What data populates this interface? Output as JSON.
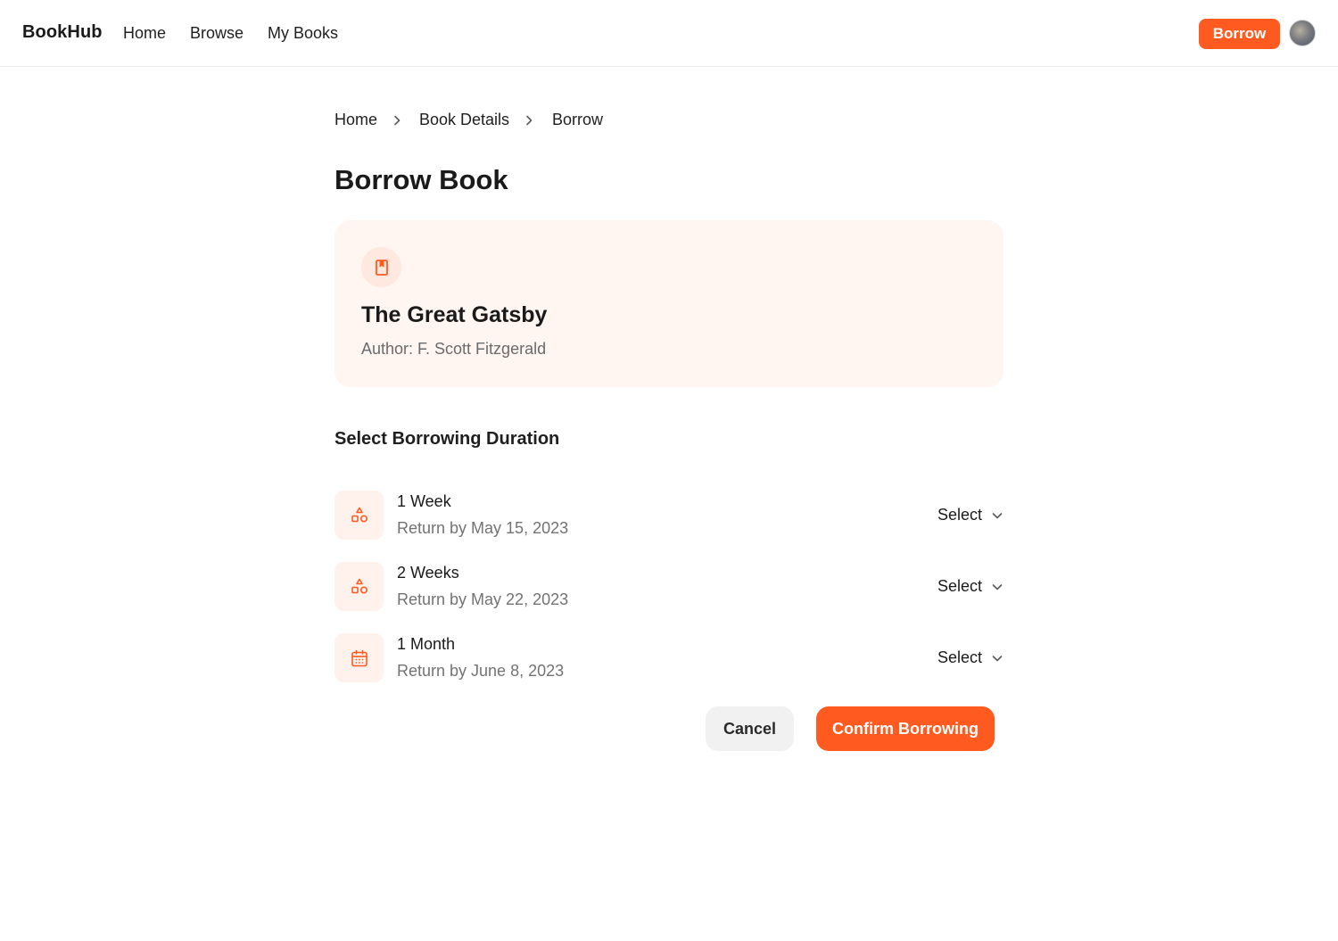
{
  "header": {
    "brand": "BookHub",
    "nav": [
      {
        "label": "Home"
      },
      {
        "label": "Browse"
      },
      {
        "label": "My Books"
      }
    ],
    "borrow_button": "Borrow",
    "avatar_icon": "user-avatar"
  },
  "breadcrumb": [
    "Home",
    "Book Details",
    "Borrow"
  ],
  "page": {
    "title": "Borrow Book"
  },
  "book": {
    "icon": "book-icon",
    "title": "The Great Gatsby",
    "author": "Author: F. Scott Fitzgerald"
  },
  "duration": {
    "label": "Select Borrowing Duration",
    "options": [
      {
        "title": "1 Week",
        "return_by": "Return by May 15, 2023",
        "select_label": "Select",
        "icon": "shapes-icon"
      },
      {
        "title": "2 Weeks",
        "return_by": "Return by May 22, 2023",
        "select_label": "Select",
        "icon": "shapes-icon"
      },
      {
        "title": "1 Month",
        "return_by": "Return by June 8, 2023",
        "select_label": "Select",
        "icon": "calendar-icon"
      }
    ]
  },
  "actions": {
    "cancel": "Cancel",
    "confirm": "Confirm Borrowing"
  },
  "colors": {
    "accent": "#ff5a1f",
    "card_bg": "#fff5f1",
    "icon_bg": "#fff2ec"
  }
}
